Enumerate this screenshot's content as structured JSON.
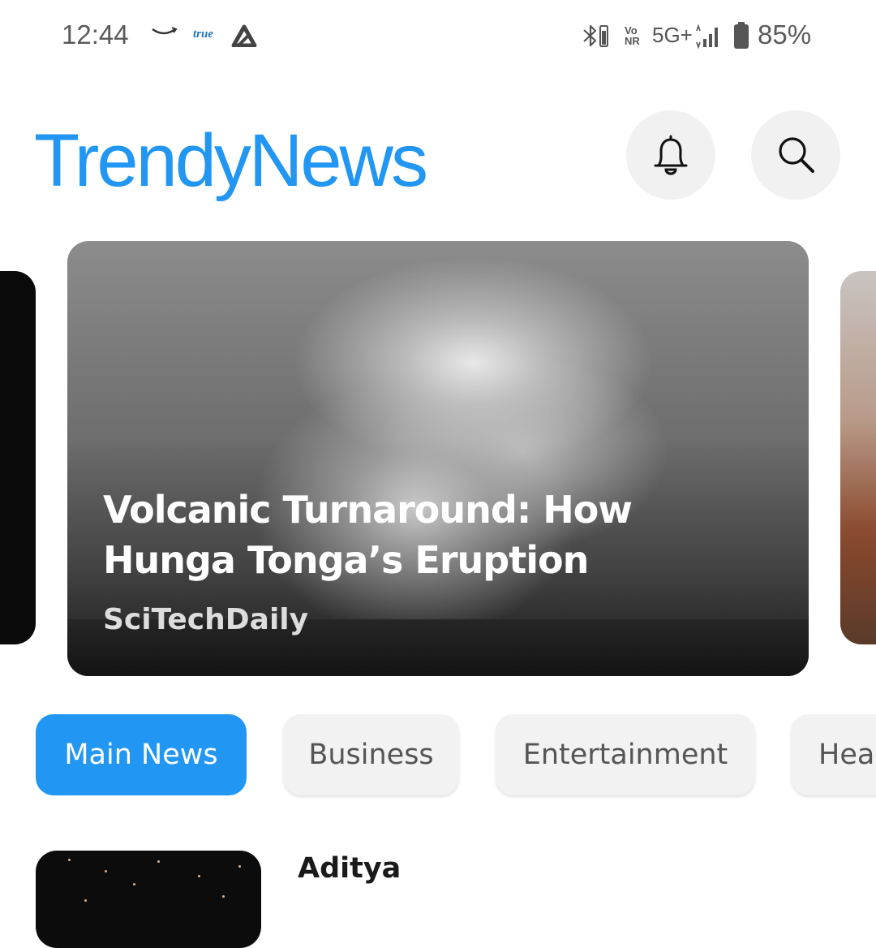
{
  "status_bar": {
    "time": "12:44",
    "carrier_logo_text": "true",
    "network": "5G+",
    "vonr_top": "Vo",
    "vonr_bottom": "NR",
    "battery_percent": "85%",
    "icons": [
      "amazon-icon",
      "true-logo-icon",
      "a-app-icon",
      "bluetooth-icon",
      "vonr-icon",
      "signal-icon",
      "battery-icon"
    ]
  },
  "header": {
    "brand": "TrendyNews",
    "brand_color": "#2196f3",
    "icons": [
      "bell-icon",
      "search-icon"
    ]
  },
  "featured": {
    "title": "Volcanic Turnaround: How Hunga Tonga’s Eruption",
    "source": "SciTechDaily"
  },
  "categories": [
    {
      "label": "Main News",
      "active": true
    },
    {
      "label": "Business",
      "active": false
    },
    {
      "label": "Entertainment",
      "active": false
    },
    {
      "label": "Hea",
      "active": false
    }
  ],
  "articles": [
    {
      "author": "Aditya"
    }
  ],
  "colors": {
    "accent": "#2196f3",
    "chip_inactive_bg": "#f2f2f2",
    "icon_button_bg": "#f1f1f1"
  }
}
